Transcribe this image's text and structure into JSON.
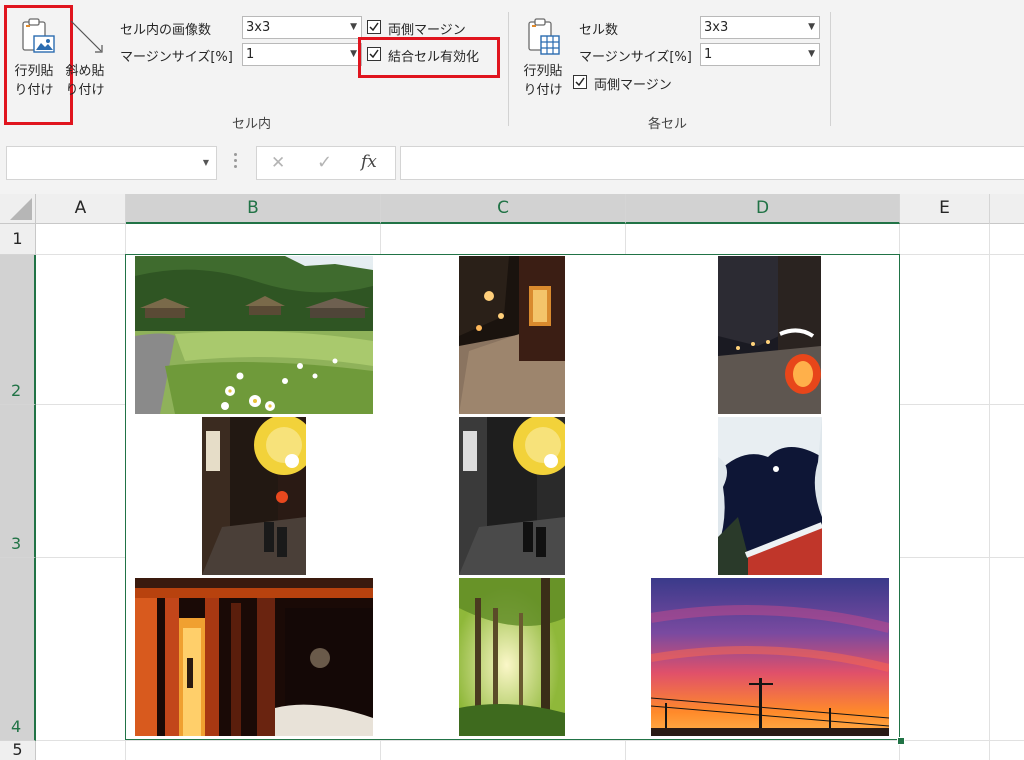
{
  "ribbon": {
    "paste_rows_button": {
      "line1": "行列貼",
      "line2": "り付け"
    },
    "paste_diagonal_button": {
      "line1": "斜め貼",
      "line2": "り付け"
    },
    "cell_group": {
      "images_in_cell_label": "セル内の画像数",
      "images_in_cell_value": "3x3",
      "margin_size_label": "マージンサイズ[%]",
      "margin_size_value": "1",
      "both_margins_label": "両側マージン",
      "both_margins_checked": true,
      "merged_cells_label": "結合セル有効化",
      "merged_cells_checked": true,
      "group_name": "セル内"
    },
    "each_cell_group": {
      "paste_button": {
        "line1": "行列貼",
        "line2": "り付け"
      },
      "cell_count_label": "セル数",
      "cell_count_value": "3x3",
      "margin_size_label": "マージンサイズ[%]",
      "margin_size_value": "1",
      "both_margins_label": "両側マージン",
      "both_margins_checked": true,
      "group_name": "各セル"
    }
  },
  "formula_bar": {
    "name_box_value": "",
    "cancel_symbol": "✕",
    "enter_symbol": "✓",
    "fx_symbol": "fx",
    "formula_value": ""
  },
  "sheet": {
    "columns": [
      "A",
      "B",
      "C",
      "D",
      "E"
    ],
    "rows": [
      "1",
      "2",
      "3",
      "4",
      "5"
    ],
    "selected_columns": [
      "B",
      "C",
      "D"
    ],
    "selected_rows": [
      "2",
      "3",
      "4"
    ]
  },
  "photos": [
    {
      "name": "photo-thatched-village",
      "subject": "thatched-roof village with daisies"
    },
    {
      "name": "photo-night-lantern-street",
      "subject": "night street with lanterns"
    },
    {
      "name": "photo-red-lantern-street",
      "subject": "night street with red lantern"
    },
    {
      "name": "photo-yellow-lantern-alley",
      "subject": "alley with yellow paper lantern"
    },
    {
      "name": "photo-yellow-lantern-alley-mono",
      "subject": "monochrome alley with yellow lantern"
    },
    {
      "name": "photo-snow-moon-shrine",
      "subject": "snowy branches, moon and shrine roof"
    },
    {
      "name": "photo-torii-night",
      "subject": "red torii gates at night"
    },
    {
      "name": "photo-forest-sunlight",
      "subject": "sunlit forest"
    },
    {
      "name": "photo-sunset-power-lines",
      "subject": "sunset sky with power lines"
    }
  ],
  "colors": {
    "ribbon_bg": "#f3f3f3",
    "highlight_red": "#e0141e",
    "excel_green": "#217346",
    "grid_line": "#e1e1e1"
  }
}
